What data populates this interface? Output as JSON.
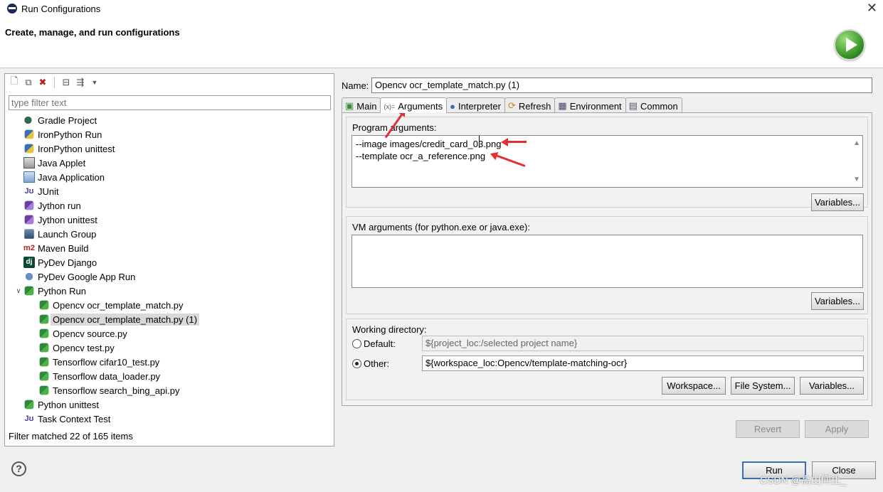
{
  "window": {
    "title": "Run Configurations",
    "subtitle": "Create, manage, and run configurations"
  },
  "left": {
    "filter_placeholder": "type filter text",
    "tree": [
      {
        "label": "Gradle Project",
        "icon": "gradle-icon",
        "level": 1
      },
      {
        "label": "IronPython Run",
        "icon": "ironpython-run-icon",
        "level": 1
      },
      {
        "label": "IronPython unittest",
        "icon": "ironpython-unittest-icon",
        "level": 1
      },
      {
        "label": "Java Applet",
        "icon": "java-applet-icon",
        "level": 1
      },
      {
        "label": "Java Application",
        "icon": "java-application-icon",
        "level": 1
      },
      {
        "label": "JUnit",
        "icon": "junit-icon",
        "level": 1
      },
      {
        "label": "Jython run",
        "icon": "jython-run-icon",
        "level": 1
      },
      {
        "label": "Jython unittest",
        "icon": "jython-unittest-icon",
        "level": 1
      },
      {
        "label": "Launch Group",
        "icon": "launch-group-icon",
        "level": 1
      },
      {
        "label": "Maven Build",
        "icon": "maven-icon",
        "level": 1
      },
      {
        "label": "PyDev Django",
        "icon": "django-icon",
        "level": 1
      },
      {
        "label": "PyDev Google App Run",
        "icon": "google-app-icon",
        "level": 1
      },
      {
        "label": "Python Run",
        "icon": "python-run-icon",
        "level": 1,
        "expanded": true
      },
      {
        "label": "Opencv ocr_template_match.py",
        "icon": "python-run-icon",
        "level": 2
      },
      {
        "label": "Opencv ocr_template_match.py (1)",
        "icon": "python-run-icon",
        "level": 2,
        "selected": true
      },
      {
        "label": "Opencv source.py",
        "icon": "python-run-icon",
        "level": 2
      },
      {
        "label": "Opencv test.py",
        "icon": "python-run-icon",
        "level": 2
      },
      {
        "label": "Tensorflow cifar10_test.py",
        "icon": "python-run-icon",
        "level": 2
      },
      {
        "label": "Tensorflow data_loader.py",
        "icon": "python-run-icon",
        "level": 2
      },
      {
        "label": "Tensorflow search_bing_api.py",
        "icon": "python-run-icon",
        "level": 2
      },
      {
        "label": "Python unittest",
        "icon": "python-unittest-icon",
        "level": 1
      },
      {
        "label": "Task Context Test",
        "icon": "task-context-icon",
        "level": 1
      }
    ],
    "status": "Filter matched 22 of 165 items"
  },
  "config": {
    "name_label": "Name:",
    "name_value": "Opencv ocr_template_match.py (1)",
    "tabs": [
      {
        "label": "Main",
        "icon": "main-tab-icon"
      },
      {
        "label": "Arguments",
        "icon": "arguments-tab-icon",
        "active": true
      },
      {
        "label": "Interpreter",
        "icon": "interpreter-tab-icon"
      },
      {
        "label": "Refresh",
        "icon": "refresh-tab-icon"
      },
      {
        "label": "Environment",
        "icon": "environment-tab-icon"
      },
      {
        "label": "Common",
        "icon": "common-tab-icon"
      }
    ],
    "program_args_label": "Program arguments:",
    "program_args_lines": [
      "--image images/credit_card_03.png",
      "--template ocr_a_reference.png"
    ],
    "vm_args_label": "VM arguments (for python.exe or java.exe):",
    "vm_args_value": "",
    "variables_label": "Variables...",
    "working_dir_label": "Working directory:",
    "default_label": "Default:",
    "default_value": "${project_loc:/selected project name}",
    "other_label": "Other:",
    "other_value": "${workspace_loc:Opencv/template-matching-ocr}",
    "workspace_btn": "Workspace...",
    "filesystem_btn": "File System...",
    "revert_btn": "Revert",
    "apply_btn": "Apply"
  },
  "footer": {
    "run_btn": "Run",
    "close_btn": "Close",
    "help": "?"
  },
  "watermark": "CSDN @高山仰止_"
}
